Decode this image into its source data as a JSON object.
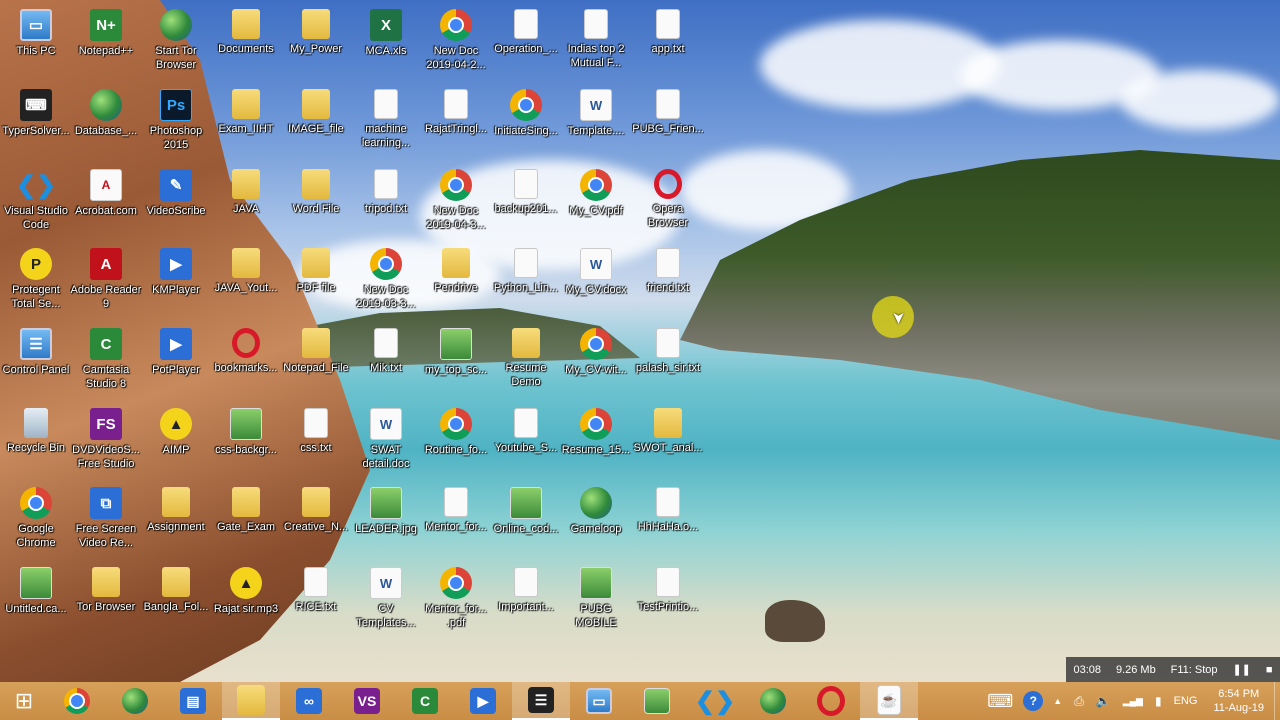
{
  "desktop": {
    "icons": [
      {
        "label": "This PC",
        "icon": "this-pc-icon",
        "glyph": "▭",
        "cls": "g-monitor"
      },
      {
        "label": "Notepad++",
        "icon": "notepad-plus-plus-icon",
        "glyph": "N+",
        "cls": "g-green"
      },
      {
        "label": "Start Tor Browser",
        "icon": "tor-browser-icon",
        "glyph": "",
        "cls": "g-globe"
      },
      {
        "label": "Documents",
        "icon": "folder-icon",
        "glyph": "",
        "cls": "g-folder"
      },
      {
        "label": "My_Power",
        "icon": "folder-icon",
        "glyph": "",
        "cls": "g-folder"
      },
      {
        "label": "MCA.xls",
        "icon": "excel-file-icon",
        "glyph": "X",
        "cls": "g-excel"
      },
      {
        "label": "New Doc 2019-04-2...",
        "icon": "chrome-icon",
        "glyph": "",
        "cls": "g-chrome"
      },
      {
        "label": "Operation_...",
        "icon": "document-icon",
        "glyph": "",
        "cls": "g-doc"
      },
      {
        "label": "Indias top 2 Mutual F...",
        "icon": "document-icon",
        "glyph": "",
        "cls": "g-doc"
      },
      {
        "label": "app.txt",
        "icon": "text-file-icon",
        "glyph": "",
        "cls": "g-doc"
      },
      {
        "label": "TyperSolver...",
        "icon": "keyboard-icon",
        "glyph": "⌨",
        "cls": "g-dark"
      },
      {
        "label": "Database_...",
        "icon": "globe-icon",
        "glyph": "",
        "cls": "g-globe"
      },
      {
        "label": "Photoshop 2015",
        "icon": "photoshop-icon",
        "glyph": "Ps",
        "cls": "g-ps"
      },
      {
        "label": "Exam_IIHT",
        "icon": "folder-icon",
        "glyph": "",
        "cls": "g-folder"
      },
      {
        "label": "IMAGE_file",
        "icon": "folder-icon",
        "glyph": "",
        "cls": "g-folder"
      },
      {
        "label": "machine learning...",
        "icon": "document-icon",
        "glyph": "",
        "cls": "g-doc"
      },
      {
        "label": "RajatTringl...",
        "icon": "document-icon",
        "glyph": "",
        "cls": "g-doc"
      },
      {
        "label": "InitiateSing...",
        "icon": "chrome-icon",
        "glyph": "",
        "cls": "g-chrome"
      },
      {
        "label": "Template....",
        "icon": "word-file-icon",
        "glyph": "W",
        "cls": "g-word"
      },
      {
        "label": "PUBG_Frien...",
        "icon": "document-icon",
        "glyph": "",
        "cls": "g-doc"
      },
      {
        "label": "Visual Studio Code",
        "icon": "vscode-icon",
        "glyph": "❮❯",
        "cls": "g-vscode"
      },
      {
        "label": "Acrobat.com",
        "icon": "acrobat-icon",
        "glyph": "A",
        "cls": "g-pdf"
      },
      {
        "label": "VideoScribe",
        "icon": "videoscribe-icon",
        "glyph": "✎",
        "cls": "g-blue"
      },
      {
        "label": "JAVA",
        "icon": "folder-icon",
        "glyph": "",
        "cls": "g-folder"
      },
      {
        "label": "Word File",
        "icon": "folder-icon",
        "glyph": "",
        "cls": "g-folder"
      },
      {
        "label": "tripod.txt",
        "icon": "text-file-icon",
        "glyph": "",
        "cls": "g-doc"
      },
      {
        "label": "New Doc 2019-04-3...",
        "icon": "chrome-icon",
        "glyph": "",
        "cls": "g-chrome"
      },
      {
        "label": "backup201...",
        "icon": "document-icon",
        "glyph": "",
        "cls": "g-doc"
      },
      {
        "label": "My_CV.pdf",
        "icon": "chrome-icon",
        "glyph": "",
        "cls": "g-chrome"
      },
      {
        "label": "Opera Browser",
        "icon": "opera-icon",
        "glyph": "",
        "cls": "g-opera"
      },
      {
        "label": "Protegent Total Se...",
        "icon": "protegent-icon",
        "glyph": "P",
        "cls": "g-yellow"
      },
      {
        "label": "Adobe Reader 9",
        "icon": "adobe-reader-icon",
        "glyph": "A",
        "cls": "g-red"
      },
      {
        "label": "KMPlayer",
        "icon": "kmplayer-icon",
        "glyph": "▶",
        "cls": "g-blue"
      },
      {
        "label": "JAVA_Yout...",
        "icon": "folder-icon",
        "glyph": "",
        "cls": "g-folder"
      },
      {
        "label": "PDF file",
        "icon": "folder-icon",
        "glyph": "",
        "cls": "g-folder"
      },
      {
        "label": "New Doc 2019-03-3...",
        "icon": "chrome-icon",
        "glyph": "",
        "cls": "g-chrome"
      },
      {
        "label": "Pendrive",
        "icon": "folder-icon",
        "glyph": "",
        "cls": "g-folder"
      },
      {
        "label": "Python_Lin...",
        "icon": "document-icon",
        "glyph": "",
        "cls": "g-doc"
      },
      {
        "label": "My_CV.docx",
        "icon": "word-file-icon",
        "glyph": "W",
        "cls": "g-word"
      },
      {
        "label": "friend.txt",
        "icon": "text-file-icon",
        "glyph": "",
        "cls": "g-doc"
      },
      {
        "label": "Control Panel",
        "icon": "control-panel-icon",
        "glyph": "☰",
        "cls": "g-monitor"
      },
      {
        "label": "Camtasia Studio 8",
        "icon": "camtasia-icon",
        "glyph": "C",
        "cls": "g-green"
      },
      {
        "label": "PotPlayer",
        "icon": "potplayer-icon",
        "glyph": "▶",
        "cls": "g-blue"
      },
      {
        "label": "bookmarks...",
        "icon": "opera-icon",
        "glyph": "",
        "cls": "g-opera"
      },
      {
        "label": "Notepad_File",
        "icon": "folder-icon",
        "glyph": "",
        "cls": "g-folder"
      },
      {
        "label": "Mik.txt",
        "icon": "text-file-icon",
        "glyph": "",
        "cls": "g-doc"
      },
      {
        "label": "my_top_sc...",
        "icon": "image-file-icon",
        "glyph": "",
        "cls": "g-img"
      },
      {
        "label": "Resume Demo",
        "icon": "folder-icon",
        "glyph": "",
        "cls": "g-folder"
      },
      {
        "label": "My_CV-wit...",
        "icon": "chrome-icon",
        "glyph": "",
        "cls": "g-chrome"
      },
      {
        "label": "palash_sir.txt",
        "icon": "text-file-icon",
        "glyph": "",
        "cls": "g-doc"
      },
      {
        "label": "Recycle Bin",
        "icon": "recycle-bin-icon",
        "glyph": "",
        "cls": "g-bin"
      },
      {
        "label": "DVDVideoS... Free Studio",
        "icon": "dvdvideosoft-icon",
        "glyph": "FS",
        "cls": "g-purple"
      },
      {
        "label": "AIMP",
        "icon": "aimp-icon",
        "glyph": "▲",
        "cls": "g-yellow"
      },
      {
        "label": "css-backgr...",
        "icon": "image-file-icon",
        "glyph": "",
        "cls": "g-img"
      },
      {
        "label": "css.txt",
        "icon": "text-file-icon",
        "glyph": "",
        "cls": "g-doc"
      },
      {
        "label": "SWAT detail.doc",
        "icon": "word-file-icon",
        "glyph": "W",
        "cls": "g-word"
      },
      {
        "label": "Routine_fo...",
        "icon": "chrome-icon",
        "glyph": "",
        "cls": "g-chrome"
      },
      {
        "label": "Youtube_S...",
        "icon": "document-icon",
        "glyph": "",
        "cls": "g-doc"
      },
      {
        "label": "Resume_15...",
        "icon": "chrome-icon",
        "glyph": "",
        "cls": "g-chrome"
      },
      {
        "label": "SWOT_anal...",
        "icon": "folder-icon",
        "glyph": "",
        "cls": "g-folder"
      },
      {
        "label": "Google Chrome",
        "icon": "chrome-icon",
        "glyph": "",
        "cls": "g-chrome"
      },
      {
        "label": "Free Screen Video Re...",
        "icon": "screen-recorder-icon",
        "glyph": "⧉",
        "cls": "g-blue"
      },
      {
        "label": "Assignment",
        "icon": "folder-icon",
        "glyph": "",
        "cls": "g-folder"
      },
      {
        "label": "Gate_Exam",
        "icon": "folder-icon",
        "glyph": "",
        "cls": "g-folder"
      },
      {
        "label": "Creative_N...",
        "icon": "folder-icon",
        "glyph": "",
        "cls": "g-folder"
      },
      {
        "label": "LEADER.jpg",
        "icon": "image-file-icon",
        "glyph": "",
        "cls": "g-img"
      },
      {
        "label": "Mentor_for...",
        "icon": "document-icon",
        "glyph": "",
        "cls": "g-doc"
      },
      {
        "label": "Online_cod...",
        "icon": "image-file-icon",
        "glyph": "",
        "cls": "g-img"
      },
      {
        "label": "Gameloop",
        "icon": "gameloop-icon",
        "glyph": "",
        "cls": "g-globe"
      },
      {
        "label": "HhHaHa.o...",
        "icon": "document-icon",
        "glyph": "",
        "cls": "g-doc"
      },
      {
        "label": "Untitled.ca...",
        "icon": "camtasia-project-icon",
        "glyph": "",
        "cls": "g-img"
      },
      {
        "label": "Tor Browser",
        "icon": "tor-browser-icon",
        "glyph": "",
        "cls": "g-folder"
      },
      {
        "label": "Bangla_Fol...",
        "icon": "folder-icon",
        "glyph": "",
        "cls": "g-folder"
      },
      {
        "label": "Rajat sir.mp3",
        "icon": "aimp-icon",
        "glyph": "▲",
        "cls": "g-yellow"
      },
      {
        "label": "RICE.txt",
        "icon": "text-file-icon",
        "glyph": "",
        "cls": "g-doc"
      },
      {
        "label": "CV Templates...",
        "icon": "word-file-icon",
        "glyph": "W",
        "cls": "g-word"
      },
      {
        "label": "Mentor_for... .pdf",
        "icon": "chrome-icon",
        "glyph": "",
        "cls": "g-chrome"
      },
      {
        "label": "Important...",
        "icon": "document-icon",
        "glyph": "",
        "cls": "g-doc"
      },
      {
        "label": "PUBG MOBILE",
        "icon": "pubg-mobile-icon",
        "glyph": "",
        "cls": "g-img"
      },
      {
        "label": "TestPrintio...",
        "icon": "document-icon",
        "glyph": "",
        "cls": "g-doc"
      }
    ]
  },
  "recording_bar": {
    "time": "03:08",
    "size": "9.26 Mb",
    "stop_hint": "F11: Stop",
    "pause_glyph": "❚❚",
    "stop_glyph": "■"
  },
  "taskbar": {
    "start_glyph": "⊞",
    "pinned": [
      {
        "name": "chrome",
        "glyph": "",
        "cls": "g-chrome",
        "active": false
      },
      {
        "name": "tor-browser",
        "glyph": "",
        "cls": "g-globe",
        "active": false
      },
      {
        "name": "file-explorer-secondary",
        "glyph": "▤",
        "cls": "g-blue",
        "active": false
      },
      {
        "name": "file-explorer",
        "glyph": "",
        "cls": "g-folder",
        "active": true
      },
      {
        "name": "arduino",
        "glyph": "∞",
        "cls": "g-blue",
        "active": false
      },
      {
        "name": "visual-studio",
        "glyph": "VS",
        "cls": "g-purple",
        "active": false
      },
      {
        "name": "camtasia",
        "glyph": "C",
        "cls": "g-green",
        "active": false
      },
      {
        "name": "potplayer",
        "glyph": "▶",
        "cls": "g-blue",
        "active": false
      },
      {
        "name": "eclipse",
        "glyph": "☰",
        "cls": "g-dark",
        "active": true
      },
      {
        "name": "notepad",
        "glyph": "▭",
        "cls": "g-monitor",
        "active": false
      },
      {
        "name": "image-viewer",
        "glyph": "",
        "cls": "g-img",
        "active": false
      },
      {
        "name": "vscode",
        "glyph": "❮❯",
        "cls": "g-vscode",
        "active": false
      },
      {
        "name": "gameloop",
        "glyph": "",
        "cls": "g-globe",
        "active": false
      },
      {
        "name": "opera",
        "glyph": "",
        "cls": "g-opera",
        "active": false
      },
      {
        "name": "java",
        "glyph": "☕",
        "cls": "g-doc",
        "active": true
      }
    ],
    "tray": {
      "keyboard_glyph": "⌨",
      "help_glyph": "?",
      "chevron_glyph": "▲",
      "printer_glyph": "⎙",
      "volume_glyph": "🔈",
      "network_glyph": "▂▄▆",
      "battery_glyph": "▮",
      "language": "ENG",
      "time": "6:54 PM",
      "date": "11-Aug-19"
    }
  }
}
